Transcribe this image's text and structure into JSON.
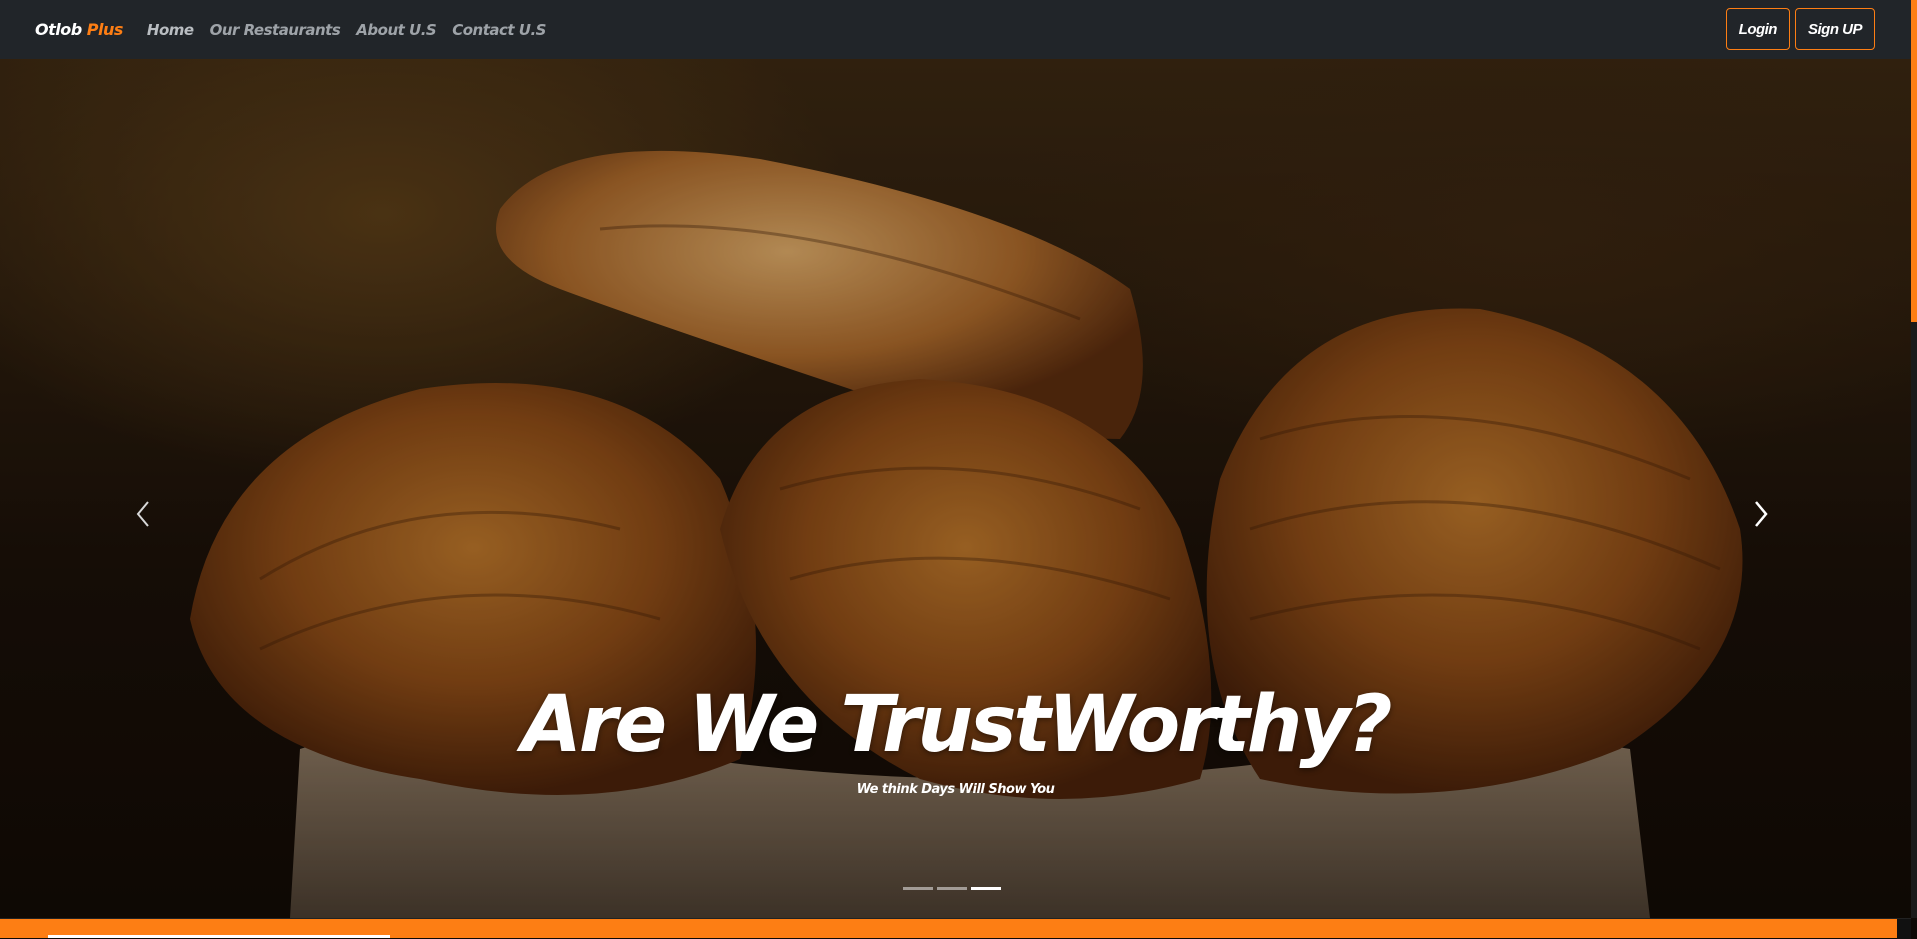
{
  "navbar": {
    "brand_main": "Otlob",
    "brand_accent": "Plus",
    "links": [
      {
        "label": "Home"
      },
      {
        "label": "Our Restaurants"
      },
      {
        "label": "About U.S"
      },
      {
        "label": "Contact U.S"
      }
    ],
    "login_label": "Login",
    "signup_label": "Sign UP"
  },
  "hero": {
    "title": "Are We TrustWorthy?",
    "subtitle": "We think Days Will Show You",
    "slide_count": 3,
    "active_slide": 3
  },
  "colors": {
    "navbar_bg": "#212529",
    "accent": "#fd7e14",
    "text": "#ffffff"
  },
  "icons": {
    "prev": "chevron-left-icon",
    "next": "chevron-right-icon"
  }
}
